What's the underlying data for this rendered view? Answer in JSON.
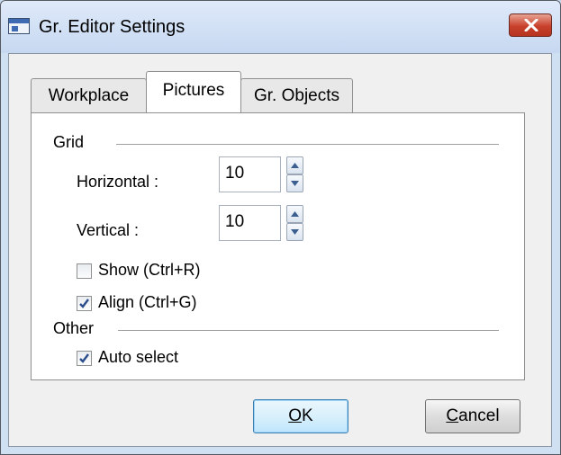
{
  "window": {
    "title": "Gr. Editor Settings",
    "icon": "window-app-icon",
    "close_icon": "close-x-icon"
  },
  "tabs": [
    {
      "label": "Workplace",
      "active": false
    },
    {
      "label": "Pictures",
      "active": true
    },
    {
      "label": "Gr. Objects",
      "active": false
    }
  ],
  "grid": {
    "group_label": "Grid",
    "horizontal": {
      "label": "Horizontal :",
      "value": "10"
    },
    "vertical": {
      "label": "Vertical :",
      "value": "10"
    },
    "show": {
      "label": "Show (Ctrl+R)",
      "checked": false
    },
    "align": {
      "label": "Align (Ctrl+G)",
      "checked": true
    }
  },
  "other": {
    "group_label": "Other",
    "auto_select": {
      "label": "Auto select",
      "checked": true
    }
  },
  "buttons": {
    "ok_mnemonic": "O",
    "ok_rest": "K",
    "cancel_mnemonic": "C",
    "cancel_rest": "ancel"
  },
  "colors": {
    "titlebar": "#cfe0f3",
    "close_button": "#c8412c",
    "default_button_border": "#3c7fb1",
    "checkmark": "#2b4d8c"
  }
}
